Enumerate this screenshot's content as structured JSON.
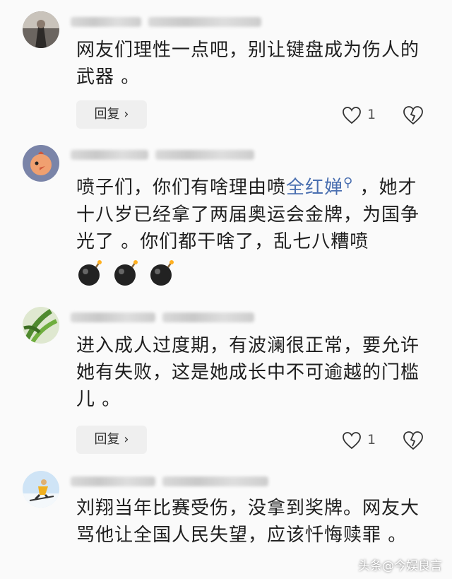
{
  "comments": [
    {
      "text": "网友们理性一点吧，别让键盘成为伤人的武器 。",
      "reply_label": "回复 ›",
      "likes": "1"
    },
    {
      "text_before": "喷子们，你们有啥理由喷",
      "mention": "全红婵",
      "text_after": " ，她才十八岁已经拿了两届奥运会金牌，为国争光了 。你们都干啥了，乱七八糟喷"
    },
    {
      "text": "进入成人过度期，有波澜很正常，要允许她有失败，这是她成长中不可逾越的门槛儿 。",
      "reply_label": "回复 ›",
      "likes": "1"
    },
    {
      "text": "刘翔当年比赛受伤，没拿到奖牌。网友大骂他让全国人民失望，应该忏悔赎罪 。"
    }
  ],
  "icons": {
    "like": "heart-outline-icon",
    "dislike": "broken-heart-icon",
    "search_mention": "search-icon",
    "emoji": "bomb-emoji-icon"
  },
  "watermark": "头条@今娱良言",
  "colors": {
    "mention": "#4a6fb0",
    "background": "#fafafa"
  }
}
